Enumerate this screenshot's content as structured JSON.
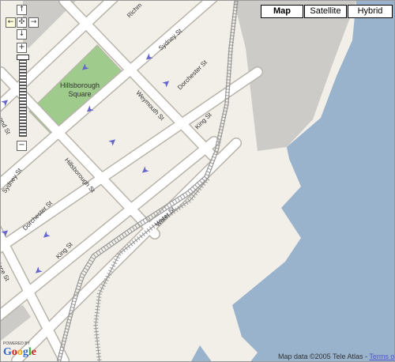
{
  "map_types": [
    {
      "label": "Map",
      "active": true
    },
    {
      "label": "Satellite",
      "active": false
    },
    {
      "label": "Hybrid",
      "active": false
    }
  ],
  "controls": {
    "pan_up": "↑",
    "pan_left": "←",
    "pan_center": "✣",
    "pan_right": "→",
    "pan_down": "↓",
    "zoom_in": "+",
    "zoom_out": "−"
  },
  "park": {
    "label": "Hillsborough Square"
  },
  "streets": {
    "richmond_top": "Richm",
    "sydney_right": "Sydney St",
    "dorchester_right": "Dorchester St",
    "weymouth": "Weymouth St",
    "king_right": "King St",
    "hillsborough": "Hillsborough St",
    "dorchester_left": "Dorchester St",
    "sydney_left": "Sydney St",
    "richmond_left": "mond St",
    "water": "Water St",
    "king_left": "King St",
    "prince": "rince St"
  },
  "footer": {
    "copyright": "Map data ©2005 Tele Atlas - ",
    "terms": "Terms of Use",
    "powered_by": "POWERED BY",
    "logo_text": "Google"
  },
  "colors": {
    "land": "#f2efe9",
    "water": "#99b3cc",
    "park": "#9fcb8c",
    "street": "#ffffff",
    "street_edge": "#b8b4aa",
    "pier": "#ccccc8"
  }
}
